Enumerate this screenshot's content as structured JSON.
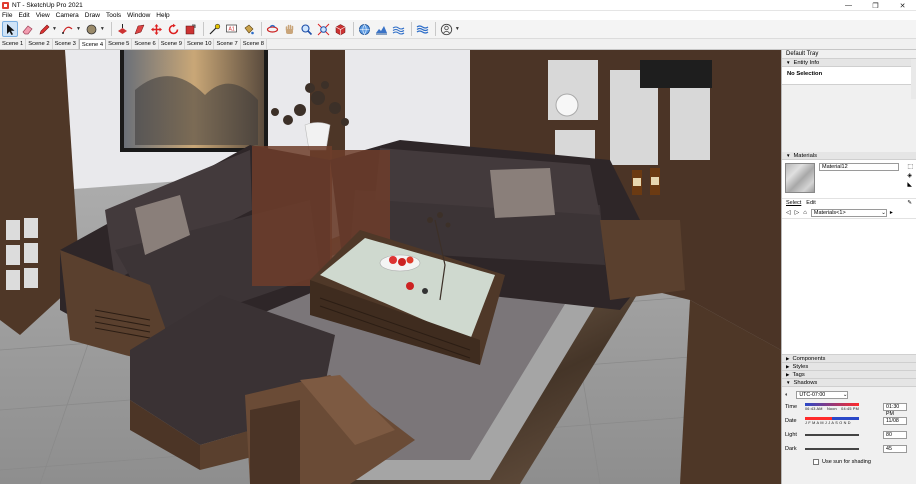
{
  "window": {
    "title": "NT - SketchUp Pro 2021",
    "minimize_glyph": "—",
    "maximize_glyph": "❐",
    "close_glyph": "✕"
  },
  "menu": [
    "File",
    "Edit",
    "View",
    "Camera",
    "Draw",
    "Tools",
    "Window",
    "Help"
  ],
  "scenes": {
    "tabs": [
      "Scene 1",
      "Scene 2",
      "Scene 3",
      "Scene 4",
      "Scene 5",
      "Scene 6",
      "Scene 9",
      "Scene 10",
      "Scene 7",
      "Scene 8"
    ],
    "active_index": 3
  },
  "tray": {
    "title": "Default Tray",
    "entity_info": {
      "header": "Entity Info",
      "selection": "No Selection"
    },
    "materials": {
      "header": "Materials",
      "name_value": "Material12",
      "tab_select": "Select",
      "tab_edit": "Edit",
      "collection_value": "Materials<1>"
    },
    "components_header": "Components",
    "styles_header": "Styles",
    "tags_header": "Tags",
    "shadows": {
      "header": "Shadows",
      "timezone_value": "UTC-07:00",
      "time_label": "Time",
      "time_marks": [
        "06:43 AM",
        "Noon",
        "04:45 PM"
      ],
      "time_value": "01:30 PM",
      "date_label": "Date",
      "months": "J F M A M J J A S O N D",
      "date_value": "11/08",
      "light_label": "Light",
      "light_value": "80",
      "dark_label": "Dark",
      "dark_value": "45",
      "use_sun_label": "Use sun for shading"
    }
  },
  "colors": {
    "floor": "#9d9c9c",
    "wood": "#4a3526",
    "fabric": "#3c3436",
    "marble": "#5c4a3c",
    "wall": "#e9e9ec"
  }
}
